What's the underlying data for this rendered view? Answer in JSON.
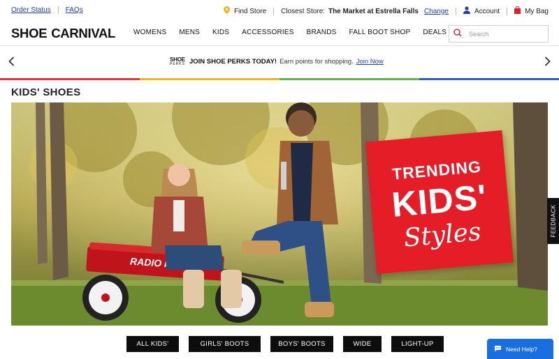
{
  "utility": {
    "order_status": "Order Status",
    "faqs": "FAQs",
    "find_store": "Find Store",
    "closest_store_label": "Closest Store:",
    "closest_store_name": "The Market at Estrella Falls",
    "change": "Change",
    "account": "Account",
    "bag": "My Bag"
  },
  "header": {
    "logo_word1": "SHOE",
    "logo_word2": "CARNIVAL",
    "nav": [
      "WOMENS",
      "MENS",
      "KIDS",
      "ACCESSORIES",
      "BRANDS",
      "FALL BOOT SHOP",
      "DEALS"
    ],
    "search_placeholder": "Search"
  },
  "promo": {
    "logo_top": "SHOE",
    "logo_bottom": "PERKS",
    "headline": "JOIN SHOE PERKS TODAY!",
    "body": "Earn points for shopping.",
    "link": "Join Now"
  },
  "colors": {
    "accent_red": "#e41d27",
    "link_blue": "#1f3fb0",
    "stripe": [
      "#e8343a",
      "#f4b41a",
      "#5cb947",
      "#2d5fc5"
    ],
    "chat_blue": "#1a6fe0"
  },
  "page": {
    "title": "KIDS' SHOES"
  },
  "hero": {
    "line1": "TRENDING",
    "line2": "KIDS'",
    "line3": "Styles",
    "wagon_text": "RADIO FLYER"
  },
  "categories": [
    "ALL KIDS'",
    "GIRLS' BOOTS",
    "BOYS' BOOTS",
    "WIDE",
    "LIGHT-UP"
  ],
  "feedback": "FEEDBACK",
  "chat": "Need Help?"
}
